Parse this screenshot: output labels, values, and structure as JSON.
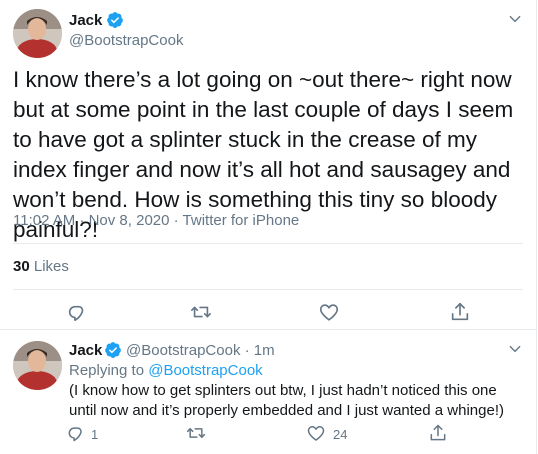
{
  "main_tweet": {
    "author_name": "Jack",
    "author_handle": "@BootstrapCook",
    "text": "I know there’s a lot going on ~out there~ right now but at some point in the last couple of days I seem to have got a splinter stuck in the crease of my index finger and now it’s all hot and sausagey and won’t bend. How is something this tiny so bloody painful?!",
    "timestamp": "11:02 AM · Nov 8, 2020 · Twitter for iPhone",
    "likes_count": "30",
    "likes_label": "Likes"
  },
  "reply_tweet": {
    "author_name": "Jack",
    "author_handle": "@BootstrapCook",
    "time_ago": "· 1m",
    "replying_to_prefix": "Replying to",
    "replying_to_handle": "@BootstrapCook",
    "text": "(I know how to get splinters out btw, I just hadn’t noticed this one until now and it’s properly embedded and I just wanted a whinge!)",
    "reply_count": "1",
    "like_count": "24"
  },
  "colors": {
    "text": "#14171a",
    "secondary": "#657786",
    "link": "#1da1f2",
    "divider": "#e6ecf0"
  },
  "icons": [
    "verified-badge-icon",
    "chevron-down-icon",
    "reply-icon",
    "retweet-icon",
    "like-icon",
    "share-icon"
  ]
}
